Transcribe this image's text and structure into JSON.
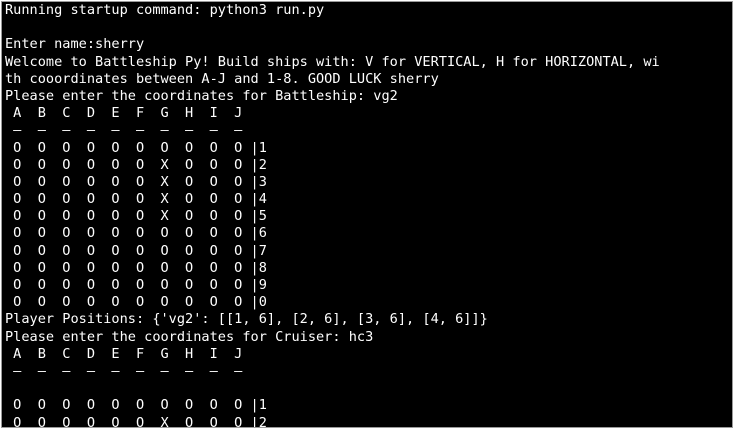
{
  "terminal": {
    "lines": [
      "Running startup command: python3 run.py",
      "",
      "Enter name:sherry",
      "Welcome to Battleship Py! Build ships with: V for VERTICAL, H for HORIZONTAL, wi",
      "th cooordinates between A-J and 1-8. GOOD LUCK sherry",
      "Please enter the coordinates for Battleship: vg2",
      " A  B  C  D  E  F  G  H  I  J",
      " —  —  —  —  —  —  —  —  —  —",
      " O  O  O  O  O  O  O  O  O  O |1",
      " O  O  O  O  O  O  X  O  O  O |2",
      " O  O  O  O  O  O  X  O  O  O |3",
      " O  O  O  O  O  O  X  O  O  O |4",
      " O  O  O  O  O  O  X  O  O  O |5",
      " O  O  O  O  O  O  O  O  O  O |6",
      " O  O  O  O  O  O  O  O  O  O |7",
      " O  O  O  O  O  O  O  O  O  O |8",
      " O  O  O  O  O  O  O  O  O  O |9",
      " O  O  O  O  O  O  O  O  O  O |0",
      "Player Positions: {'vg2': [[1, 6], [2, 6], [3, 6], [4, 6]]}",
      "Please enter the coordinates for Cruiser: hc3",
      " A  B  C  D  E  F  G  H  I  J",
      " —  —  —  —  —  —  —  —  —  —",
      "",
      " O  O  O  O  O  O  O  O  O  O |1",
      " O  O  O  O  O  O  X  O  O  O |2"
    ]
  }
}
